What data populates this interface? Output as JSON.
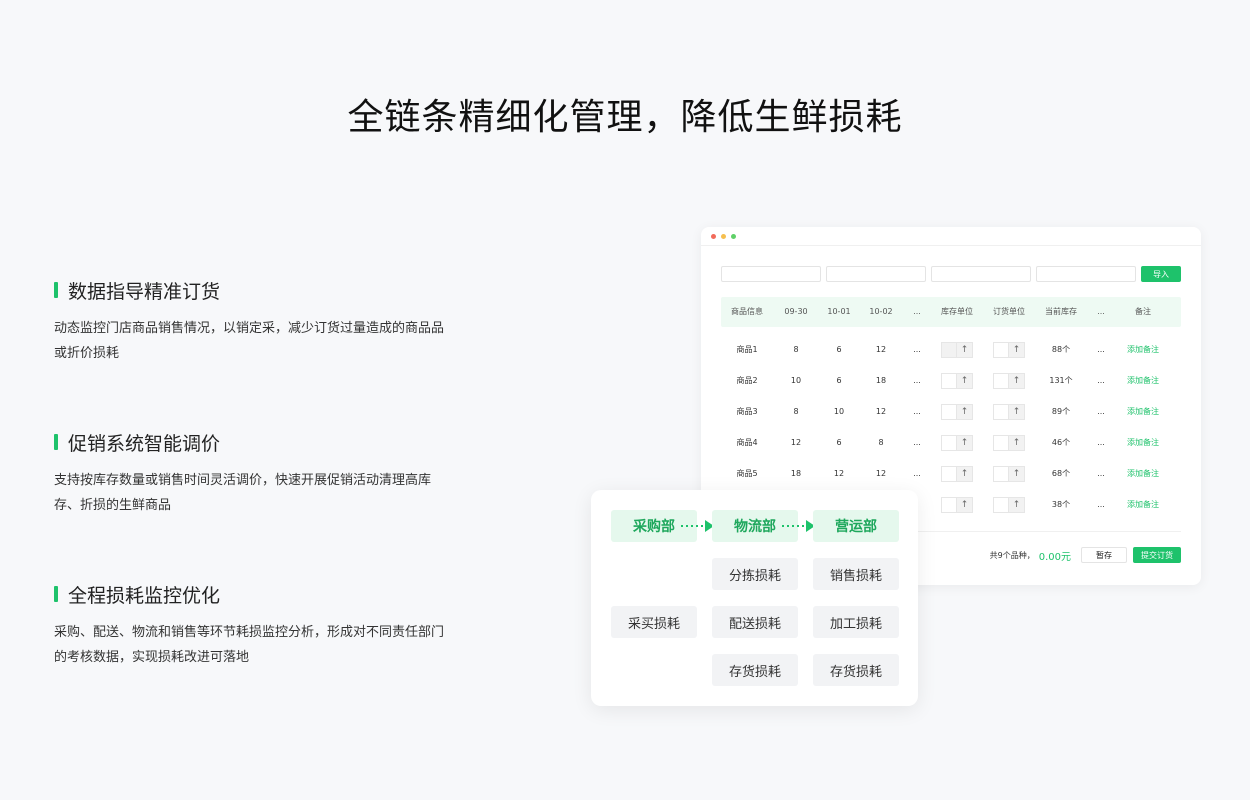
{
  "page": {
    "title": "全链条精细化管理，降低生鲜损耗"
  },
  "features": [
    {
      "title": "数据指导精准订货",
      "desc": "动态监控门店商品销售情况，以销定采，减少订货过量造成的商品品或折价损耗"
    },
    {
      "title": "促销系统智能调价",
      "desc": "支持按库存数量或销售时间灵活调价，快速开展促销活动清理高库存、折损的生鲜商品"
    },
    {
      "title": "全程损耗监控优化",
      "desc": "采购、配送、物流和销售等环节耗损监控分析，形成对不同责任部门的考核数据，实现损耗改进可落地"
    }
  ],
  "colors": {
    "accent": "#1ec26b",
    "dot_red": "#f26b5b",
    "dot_yellow": "#f6bf4f",
    "dot_green": "#5fd068"
  },
  "table": {
    "import_label": "导入",
    "headers": [
      "商品信息",
      "09-30",
      "10-01",
      "10-02",
      "...",
      "库存单位",
      "订货单位",
      "当前库存",
      "...",
      "备注"
    ],
    "rows": [
      {
        "name": "商品1",
        "d1": "8",
        "d2": "6",
        "d3": "12",
        "more": "...",
        "stock": "88个",
        "more2": "...",
        "note": "添加备注"
      },
      {
        "name": "商品2",
        "d1": "10",
        "d2": "6",
        "d3": "18",
        "more": "...",
        "stock": "131个",
        "more2": "...",
        "note": "添加备注"
      },
      {
        "name": "商品3",
        "d1": "8",
        "d2": "10",
        "d3": "12",
        "more": "...",
        "stock": "89个",
        "more2": "...",
        "note": "添加备注"
      },
      {
        "name": "商品4",
        "d1": "12",
        "d2": "6",
        "d3": "8",
        "more": "...",
        "stock": "46个",
        "more2": "...",
        "note": "添加备注"
      },
      {
        "name": "商品5",
        "d1": "18",
        "d2": "12",
        "d3": "12",
        "more": "...",
        "stock": "68个",
        "more2": "...",
        "note": "添加备注"
      },
      {
        "name": "",
        "d1": "",
        "d2": "",
        "d3": "",
        "more": "",
        "stock": "38个",
        "more2": "...",
        "note": "添加备注"
      }
    ],
    "footer": {
      "total_label": "共9个品种，",
      "total_amount": "0.00元",
      "draft_label": "暂存",
      "submit_label": "提交订货"
    }
  },
  "flow": {
    "depts": [
      "采购部",
      "物流部",
      "营运部"
    ],
    "losses": {
      "procure": "采买损耗",
      "logistics": [
        "分拣损耗",
        "配送损耗",
        "存货损耗"
      ],
      "ops": [
        "销售损耗",
        "加工损耗",
        "存货损耗"
      ]
    }
  }
}
